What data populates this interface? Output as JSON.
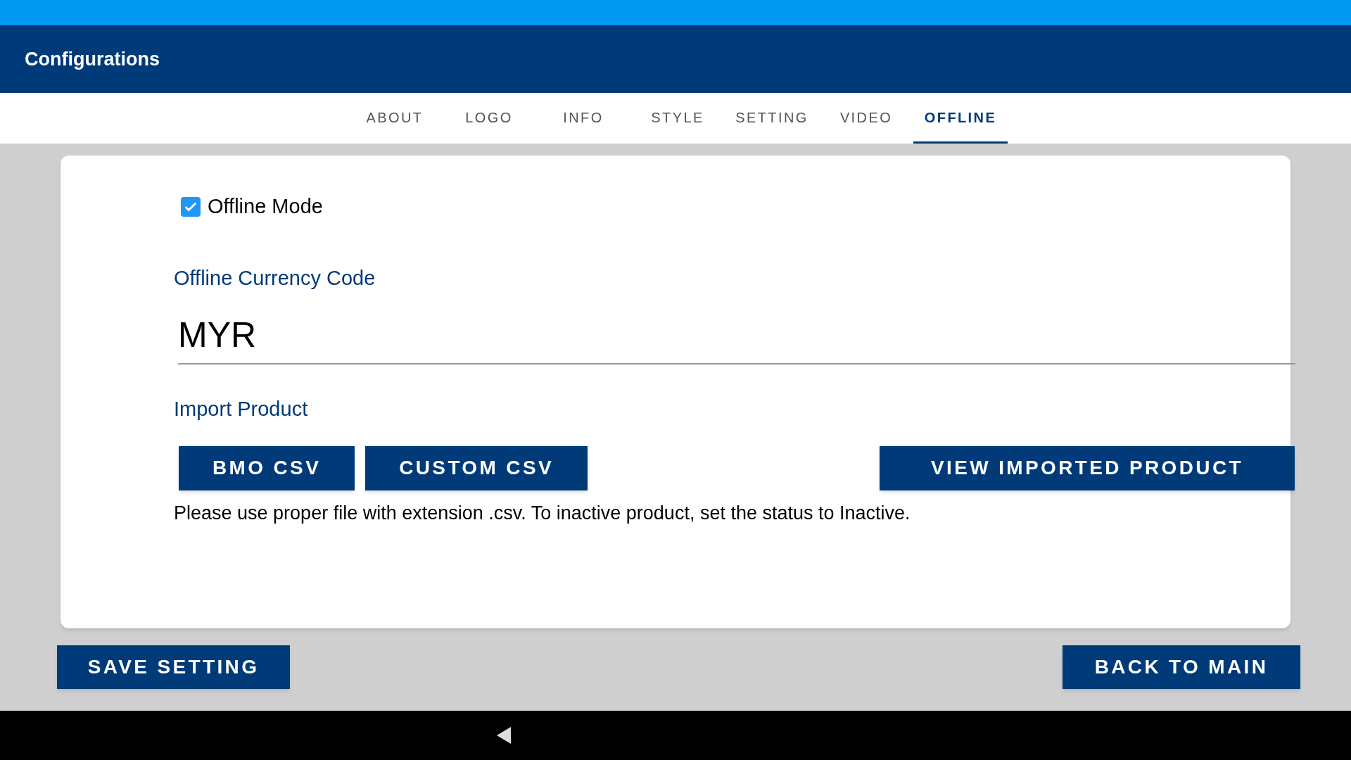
{
  "header": {
    "title": "Configurations"
  },
  "tabs": [
    {
      "label": "ABOUT",
      "selected": false
    },
    {
      "label": "LOGO",
      "selected": false
    },
    {
      "label": "INFO",
      "selected": false
    },
    {
      "label": "STYLE",
      "selected": false
    },
    {
      "label": "SETTING",
      "selected": false
    },
    {
      "label": "VIDEO",
      "selected": false
    },
    {
      "label": "OFFLINE",
      "selected": true
    }
  ],
  "offline_mode": {
    "label": "Offline Mode",
    "checked": true
  },
  "currency": {
    "label": "Offline Currency Code",
    "value": "MYR"
  },
  "import": {
    "label": "Import Product",
    "buttons": [
      "BMO CSV",
      "CUSTOM CSV"
    ],
    "view_button": "VIEW IMPORTED PRODUCT",
    "note": "Please use proper file with extension .csv. To inactive product, set the status to Inactive."
  },
  "footer": {
    "save": "SAVE SETTING",
    "back": "BACK TO MAIN"
  }
}
